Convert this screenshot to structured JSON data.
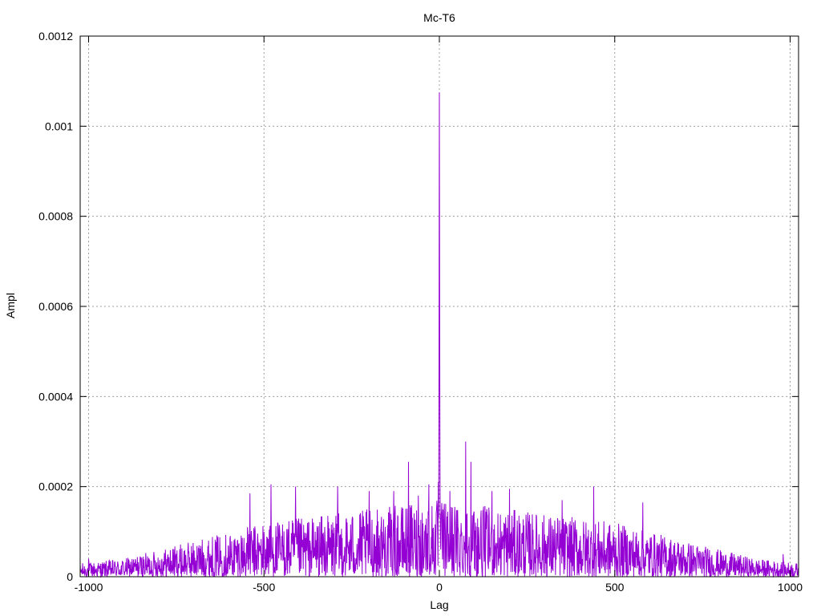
{
  "chart_data": {
    "type": "line",
    "title": "Mc-T6",
    "xlabel": "Lag",
    "ylabel": "Ampl",
    "xlim": [
      -1024,
      1024
    ],
    "ylim": [
      0,
      0.0012
    ],
    "x_ticks": [
      -1000,
      -500,
      0,
      500,
      1000
    ],
    "x_tick_labels": [
      "-1000",
      "-500",
      "0",
      "500",
      "1000"
    ],
    "y_ticks": [
      0,
      0.0002,
      0.0004,
      0.0006,
      0.0008,
      0.001,
      0.0012
    ],
    "y_tick_labels": [
      "0",
      "0.0002",
      "0.0004",
      "0.0006",
      "0.0008",
      "0.001",
      "0.0012"
    ],
    "grid": true,
    "series": [
      {
        "color": "#9400d3",
        "sampling": "one value per integer lag from -1024 to 1024; envelope values below are approximate amplitude bounds",
        "envelope": {
          "x": [
            -1024,
            -900,
            -800,
            -700,
            -600,
            -500,
            -400,
            -300,
            -200,
            -100,
            -20,
            0,
            20,
            100,
            200,
            300,
            400,
            500,
            600,
            700,
            800,
            900,
            1024
          ],
          "y": [
            3e-05,
            4e-05,
            6e-05,
            8e-05,
            0.0001,
            0.00012,
            0.00013,
            0.00014,
            0.00015,
            0.00016,
            0.00017,
            0.00017,
            0.00017,
            0.00016,
            0.00015,
            0.00014,
            0.00013,
            0.00012,
            0.0001,
            8e-05,
            6e-05,
            4e-05,
            3e-05
          ]
        },
        "peaks": [
          {
            "x": 0,
            "y": 0.001075
          },
          {
            "x": 1,
            "y": 0.000545
          },
          {
            "x": -1,
            "y": 0.000465
          },
          {
            "x": -3,
            "y": 0.00021
          },
          {
            "x": 2,
            "y": 0.00019
          },
          {
            "x": -88,
            "y": 0.000255
          },
          {
            "x": -60,
            "y": 0.00018
          },
          {
            "x": -30,
            "y": 0.000205
          },
          {
            "x": 75,
            "y": 0.0003
          },
          {
            "x": 90,
            "y": 0.000255
          },
          {
            "x": 30,
            "y": 0.00019
          },
          {
            "x": 150,
            "y": 0.00019
          },
          {
            "x": 200,
            "y": 0.000195
          },
          {
            "x": -480,
            "y": 0.000205
          },
          {
            "x": -540,
            "y": 0.000185
          },
          {
            "x": -410,
            "y": 0.0002
          },
          {
            "x": -290,
            "y": 0.0002
          },
          {
            "x": -200,
            "y": 0.00019
          },
          {
            "x": -130,
            "y": 0.00019
          },
          {
            "x": 440,
            "y": 0.0002
          },
          {
            "x": 580,
            "y": 0.000165
          },
          {
            "x": 350,
            "y": 0.00017
          },
          {
            "x": -1000,
            "y": 4e-05
          },
          {
            "x": 980,
            "y": 5e-05
          }
        ]
      }
    ]
  }
}
